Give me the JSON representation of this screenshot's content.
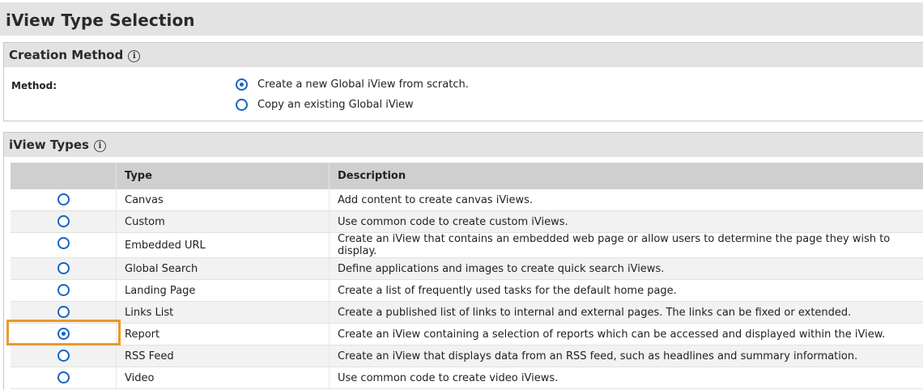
{
  "page": {
    "title": "iView Type Selection"
  },
  "creation_method": {
    "title": "Creation Method",
    "info_icon": "info-icon",
    "method_label": "Method:",
    "options": [
      {
        "label": "Create a new Global iView from scratch.",
        "selected": true
      },
      {
        "label": "Copy an existing Global iView",
        "selected": false
      }
    ]
  },
  "iview_types": {
    "title": "iView Types",
    "info_icon": "info-icon",
    "columns": [
      "",
      "Type",
      "Description"
    ],
    "rows": [
      {
        "type": "Canvas",
        "description": "Add content to create canvas iViews.",
        "selected": false
      },
      {
        "type": "Custom",
        "description": "Use common code to create custom iViews.",
        "selected": false
      },
      {
        "type": "Embedded URL",
        "description": "Create an iView that contains an embedded web page or allow users to determine the page they wish to display.",
        "selected": false
      },
      {
        "type": "Global Search",
        "description": "Define applications and images to create quick search iViews.",
        "selected": false
      },
      {
        "type": "Landing Page",
        "description": "Create a list of frequently used tasks for the default home page.",
        "selected": false
      },
      {
        "type": "Links List",
        "description": "Create a published list of links to internal and external pages. The links can be fixed or extended.",
        "selected": false
      },
      {
        "type": "Report",
        "description": "Create an iView containing a selection of reports which can be accessed and displayed within the iView.",
        "selected": true
      },
      {
        "type": "RSS Feed",
        "description": "Create an iView that displays data from an RSS feed, such as headlines and summary information.",
        "selected": false
      },
      {
        "type": "Video",
        "description": "Use common code to create video iViews.",
        "selected": false
      }
    ]
  },
  "colors": {
    "accent": "#1565c0",
    "highlight": "#e89a2c",
    "header_bg": "#e3e3e3"
  }
}
